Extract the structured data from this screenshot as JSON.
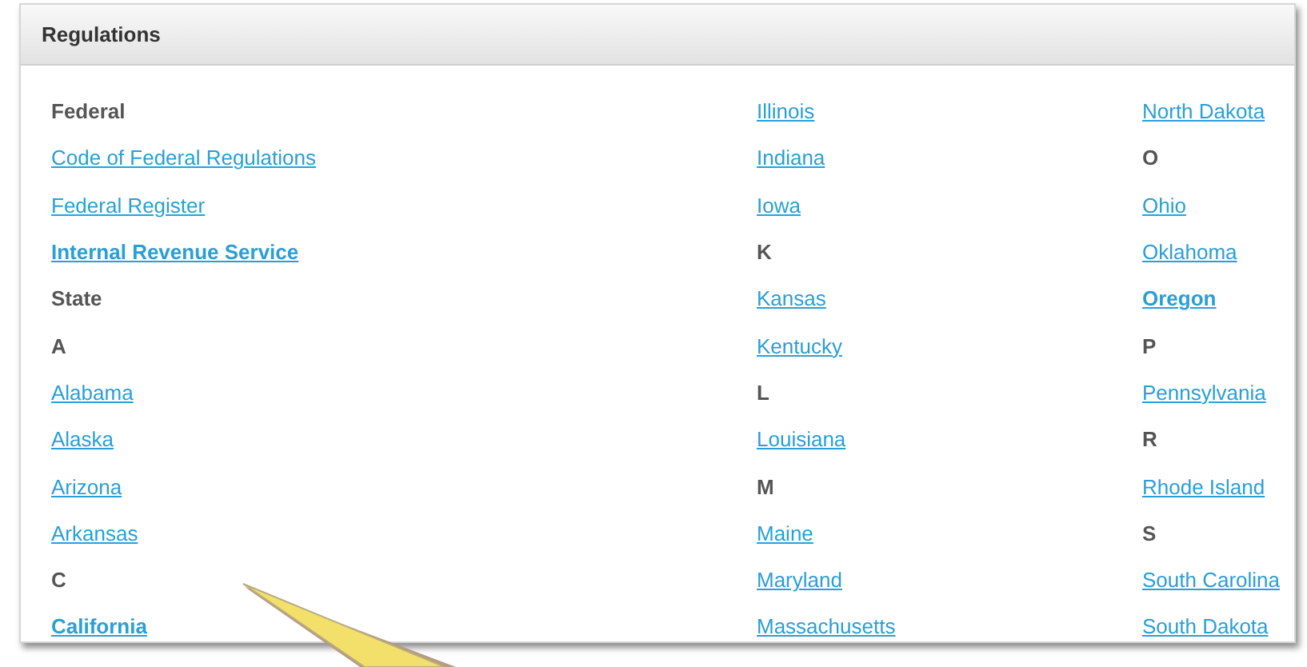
{
  "panel": {
    "title": "Regulations"
  },
  "columns": [
    [
      {
        "kind": "heading",
        "text": "Federal"
      },
      {
        "kind": "link",
        "text": "Code of Federal Regulations",
        "emphasized": false
      },
      {
        "kind": "link",
        "text": "Federal Register",
        "emphasized": false
      },
      {
        "kind": "link",
        "text": "Internal Revenue Service",
        "emphasized": true
      },
      {
        "kind": "heading",
        "text": "State"
      },
      {
        "kind": "heading",
        "text": "A"
      },
      {
        "kind": "link",
        "text": "Alabama",
        "emphasized": false
      },
      {
        "kind": "link",
        "text": "Alaska",
        "emphasized": false
      },
      {
        "kind": "link",
        "text": "Arizona",
        "emphasized": false
      },
      {
        "kind": "link",
        "text": "Arkansas",
        "emphasized": false
      },
      {
        "kind": "heading",
        "text": "C"
      },
      {
        "kind": "link",
        "text": "California",
        "emphasized": true
      }
    ],
    [
      {
        "kind": "link",
        "text": "Illinois",
        "emphasized": false
      },
      {
        "kind": "link",
        "text": "Indiana",
        "emphasized": false
      },
      {
        "kind": "link",
        "text": "Iowa",
        "emphasized": false
      },
      {
        "kind": "heading",
        "text": "K"
      },
      {
        "kind": "link",
        "text": "Kansas",
        "emphasized": false
      },
      {
        "kind": "link",
        "text": "Kentucky",
        "emphasized": false
      },
      {
        "kind": "heading",
        "text": "L"
      },
      {
        "kind": "link",
        "text": "Louisiana",
        "emphasized": false
      },
      {
        "kind": "heading",
        "text": "M"
      },
      {
        "kind": "link",
        "text": "Maine",
        "emphasized": false
      },
      {
        "kind": "link",
        "text": "Maryland",
        "emphasized": false
      },
      {
        "kind": "link",
        "text": "Massachusetts",
        "emphasized": false
      }
    ],
    [
      {
        "kind": "link",
        "text": "North Dakota",
        "emphasized": false
      },
      {
        "kind": "heading",
        "text": "O"
      },
      {
        "kind": "link",
        "text": "Ohio",
        "emphasized": false
      },
      {
        "kind": "link",
        "text": "Oklahoma",
        "emphasized": false
      },
      {
        "kind": "link",
        "text": "Oregon",
        "emphasized": true
      },
      {
        "kind": "heading",
        "text": "P"
      },
      {
        "kind": "link",
        "text": "Pennsylvania",
        "emphasized": false
      },
      {
        "kind": "heading",
        "text": "R"
      },
      {
        "kind": "link",
        "text": "Rhode Island",
        "emphasized": false
      },
      {
        "kind": "heading",
        "text": "S"
      },
      {
        "kind": "link",
        "text": "South Carolina",
        "emphasized": false
      },
      {
        "kind": "link",
        "text": "South Dakota",
        "emphasized": false
      }
    ]
  ]
}
